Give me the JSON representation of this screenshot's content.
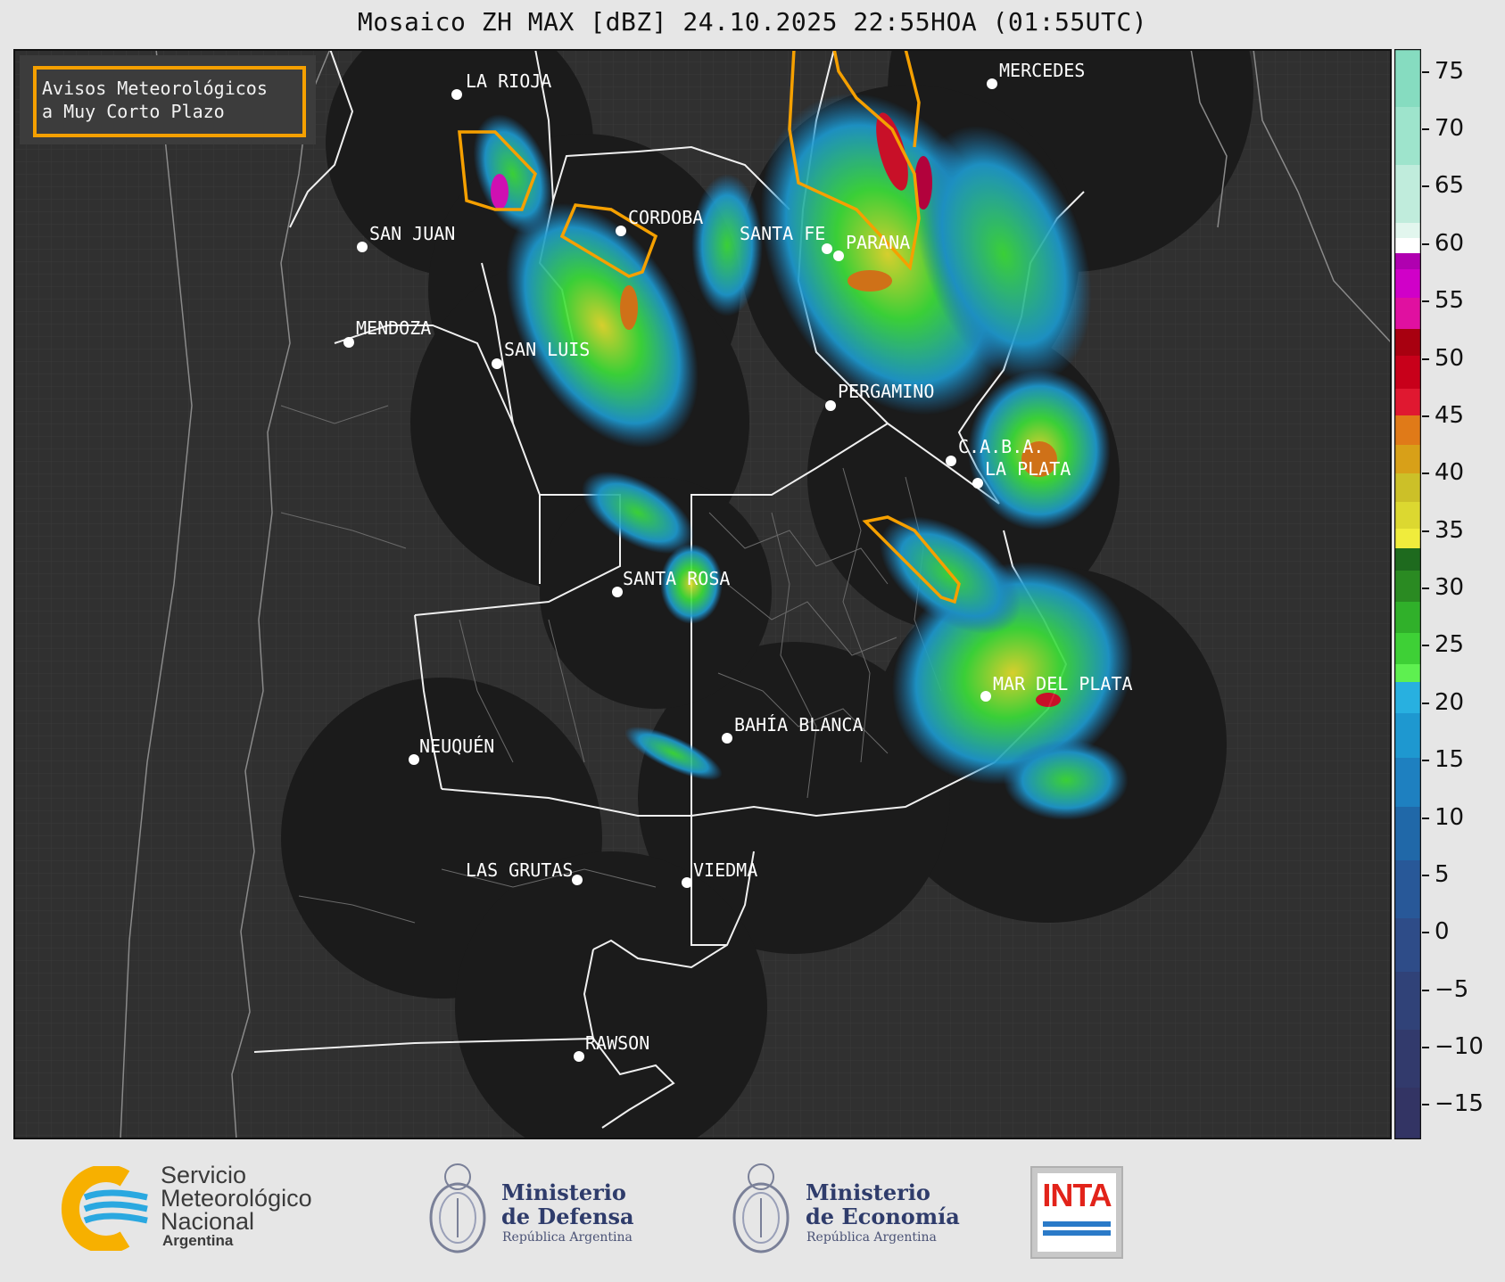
{
  "title": "Mosaico ZH MAX [dBZ] 24.10.2025 22:55HOA (01:55UTC)",
  "legend": {
    "line1": "Avisos Meteorológicos",
    "line2": "a Muy Corto Plazo",
    "color": "#f5a000"
  },
  "colorbar": {
    "ticks": [
      "75",
      "70",
      "65",
      "60",
      "55",
      "50",
      "45",
      "40",
      "35",
      "30",
      "25",
      "20",
      "15",
      "10",
      "5",
      "0",
      "−5",
      "−10",
      "−15"
    ],
    "range": [
      -18,
      77
    ],
    "colors": {
      "low": "#2c3a6a",
      "blue": "#1e78b8",
      "green": "#3ee03a",
      "yellow": "#e8e030",
      "orange": "#e07a18",
      "red": "#d8102a",
      "magenta": "#e010c0",
      "teal": "#86dcc0"
    }
  },
  "cities": [
    {
      "name": "LA RIOJA"
    },
    {
      "name": "MERCEDES"
    },
    {
      "name": "CORDOBA"
    },
    {
      "name": "SAN JUAN"
    },
    {
      "name": "SANTA FE"
    },
    {
      "name": "PARANA"
    },
    {
      "name": "MENDOZA"
    },
    {
      "name": "SAN LUIS"
    },
    {
      "name": "PERGAMINO"
    },
    {
      "name": "C.A.B.A."
    },
    {
      "name": "LA PLATA"
    },
    {
      "name": "SANTA ROSA"
    },
    {
      "name": "MAR DEL PLATA"
    },
    {
      "name": "BAHÍA BLANCA"
    },
    {
      "name": "NEUQUÉN"
    },
    {
      "name": "LAS GRUTAS"
    },
    {
      "name": "VIEDMA"
    },
    {
      "name": "RAWSON"
    }
  ],
  "logos": {
    "smn_line1": "Servicio",
    "smn_line2": "Meteorológico",
    "smn_line3": "Nacional",
    "smn_line4": "Argentina",
    "defensa_line1": "Ministerio",
    "defensa_line2": "de Defensa",
    "defensa_sub": "República Argentina",
    "economia_line1": "Ministerio",
    "economia_line2": "de Economía",
    "economia_sub": "República Argentina",
    "inta": "INTA"
  }
}
